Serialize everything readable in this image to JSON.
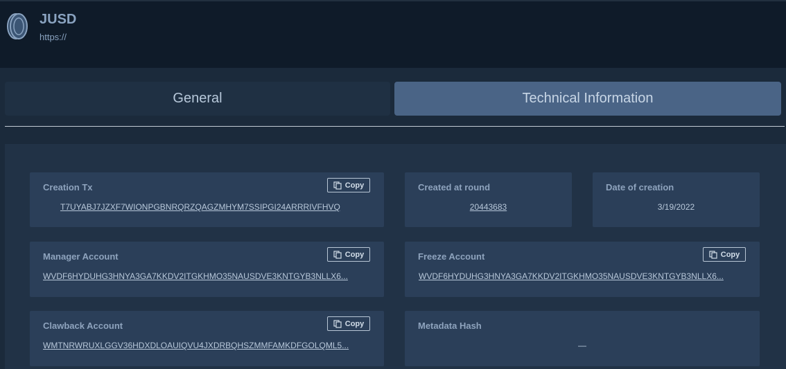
{
  "asset": {
    "name": "JUSD",
    "url": "https://"
  },
  "tabs": [
    {
      "label": "General",
      "active": false
    },
    {
      "label": "Technical Information",
      "active": true
    }
  ],
  "copy_label": "Copy",
  "cards": {
    "creation_tx": {
      "label": "Creation Tx",
      "value": "T7UYABJ7JZXF7WIONPGBNRQRZQAGZMHYM7SSIPGI24ARRRIVFHVQ"
    },
    "created_round": {
      "label": "Created at round",
      "value": "20443683"
    },
    "creation_date": {
      "label": "Date of creation",
      "value": "3/19/2022"
    },
    "manager": {
      "label": "Manager Account",
      "value": "WVDF6HYDUHG3HNYA3GA7KKDV2ITGKHMO35NAUSDVE3KNTGYB3NLLX6..."
    },
    "freeze": {
      "label": "Freeze Account",
      "value": "WVDF6HYDUHG3HNYA3GA7KKDV2ITGKHMO35NAUSDVE3KNTGYB3NLLX6..."
    },
    "clawback": {
      "label": "Clawback Account",
      "value": "WMTNRWRUXLGGV36HDXDLOAUIQVU4JXDRBQHSZMMFAMKDFGOLQML5..."
    },
    "metadata_hash": {
      "label": "Metadata Hash",
      "value": "—"
    }
  },
  "colors": {
    "background": "#1b2a3b",
    "header": "#0f1b29",
    "card": "#2b3f59",
    "active_tab": "#4a6486",
    "inactive_tab": "#1f3043"
  },
  "icons": {
    "coin": "coin-icon",
    "copy": "copy-icon"
  }
}
